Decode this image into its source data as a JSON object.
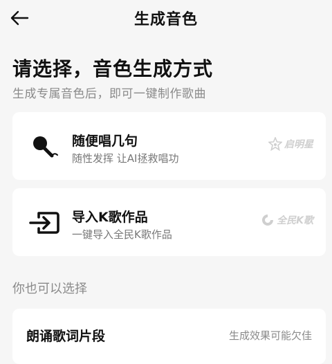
{
  "header": {
    "title": "生成音色"
  },
  "intro": {
    "heading": "请选择，音色生成方式",
    "subheading": "生成专属音色后，即可一键制作歌曲"
  },
  "options": [
    {
      "title": "随便唱几句",
      "description": "随性发挥 让AI拯救唱功",
      "brand": "启明星",
      "icon": "microphone-icon"
    },
    {
      "title": "导入K歌作品",
      "description": "一键导入全民K歌作品",
      "brand": "全民K歌",
      "icon": "import-icon"
    }
  ],
  "more": {
    "label": "你也可以选择",
    "items": [
      {
        "title": "朗诵歌词片段",
        "hint": "生成效果可能欠佳"
      }
    ]
  },
  "colors": {
    "background": "#f6f6f6",
    "card": "#ffffff",
    "muted": "#8a8a8a",
    "brand_watermark": "#cfcfcf"
  }
}
